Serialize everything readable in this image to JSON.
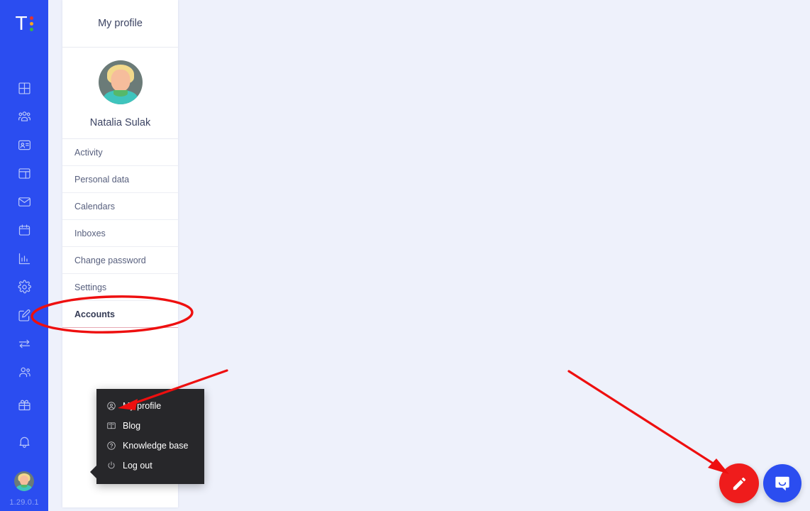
{
  "app": {
    "logo_letter": "T",
    "logo_dot_colors": [
      "#e8342a",
      "#f5a623",
      "#38b44a"
    ],
    "version": "1.29.0.1",
    "accent_blue": "#2b4df0",
    "background": "#eef1fb"
  },
  "rail": {
    "top_items": [
      {
        "name": "dashboard-icon",
        "label": "Dashboard"
      },
      {
        "name": "team-icon",
        "label": "Team"
      },
      {
        "name": "contact-card-icon",
        "label": "Contacts"
      },
      {
        "name": "board-icon",
        "label": "Board"
      },
      {
        "name": "mail-icon",
        "label": "Mail"
      },
      {
        "name": "calendar-icon",
        "label": "Calendar"
      },
      {
        "name": "bar-chart-icon",
        "label": "Reports"
      },
      {
        "name": "gear-icon",
        "label": "Settings"
      },
      {
        "name": "edit-square-icon",
        "label": "Editor"
      },
      {
        "name": "transfer-icon",
        "label": "Transfers"
      },
      {
        "name": "users-icon",
        "label": "Users"
      }
    ],
    "bottom_items": [
      {
        "name": "gift-icon",
        "label": "Gifts"
      },
      {
        "name": "bell-icon",
        "label": "Notifications"
      }
    ],
    "avatar_label": "Natalia Sulak"
  },
  "profile_panel": {
    "header_title": "My profile",
    "user_name": "Natalia Sulak",
    "items": [
      {
        "label": "Activity",
        "active": false
      },
      {
        "label": "Personal data",
        "active": false
      },
      {
        "label": "Calendars",
        "active": false
      },
      {
        "label": "Inboxes",
        "active": false
      },
      {
        "label": "Change password",
        "active": false
      },
      {
        "label": "Settings",
        "active": false
      },
      {
        "label": "Accounts",
        "active": true
      }
    ]
  },
  "context_menu": {
    "items": [
      {
        "label": "My profile",
        "icon": "user-circle-icon"
      },
      {
        "label": "Blog",
        "icon": "book-icon"
      },
      {
        "label": "Knowledge base",
        "icon": "question-circle-icon"
      },
      {
        "label": "Log out",
        "icon": "power-icon"
      }
    ]
  },
  "floating": {
    "edit_button_label": "Create",
    "chat_button_label": "Open chat",
    "edit_color": "#ef1c1c",
    "chat_color": "#2b4df0"
  },
  "annotations": {
    "color": "#ee0f0f",
    "ellipse_target": "Accounts",
    "arrow1_target": "My profile",
    "arrow2_target": "Create"
  }
}
